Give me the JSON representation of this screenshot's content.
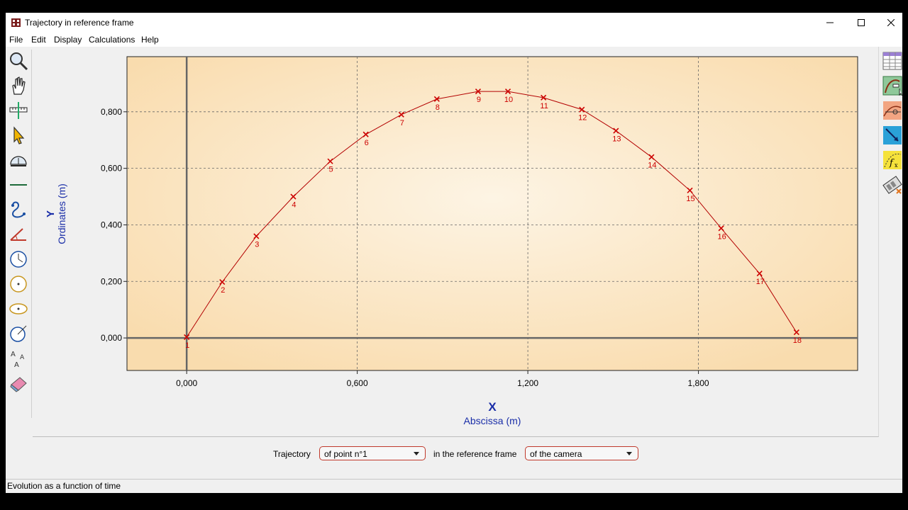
{
  "window": {
    "title": "Trajectory in reference frame"
  },
  "menu": {
    "items": [
      "File",
      "Edit",
      "Display",
      "Calculations",
      "Help"
    ]
  },
  "left_tools": [
    "magnifier-icon",
    "hand-icon",
    "axis-ruler-icon",
    "pointer-icon",
    "protractor-icon",
    "line-icon",
    "curve-icon",
    "angle-icon",
    "clock-circle-icon",
    "center-circle-icon",
    "ellipse-icon",
    "radius-circle-icon",
    "text-label-icon",
    "eraser-icon"
  ],
  "right_tools": [
    "table-icon",
    "trajectory-icon",
    "vector-icon",
    "arrow-icon",
    "function-icon",
    "film-icon"
  ],
  "chart_data": {
    "type": "scatter",
    "xlabel_symbol": "X",
    "xlabel": "Abscissa (m)",
    "ylabel_symbol": "Y",
    "ylabel": "Ordinates (m)",
    "xlim": [
      -0.21,
      2.36
    ],
    "ylim": [
      -0.115,
      0.995
    ],
    "x_ticks": [
      0,
      0.6,
      1.2,
      1.8
    ],
    "x_tick_labels": [
      "0,000",
      "0,600",
      "1,200",
      "1,800"
    ],
    "y_ticks": [
      0,
      0.2,
      0.4,
      0.6,
      0.8
    ],
    "y_tick_labels": [
      "0,000",
      "0,200",
      "0,400",
      "0,600",
      "0,800"
    ],
    "grid": true,
    "background": "#fbe7c6",
    "point_color": "#cc0000",
    "line_color": "#b30000",
    "series": [
      {
        "labels": [
          "1",
          "2",
          "3",
          "4",
          "5",
          "6",
          "7",
          "8",
          "9",
          "10",
          "11",
          "12",
          "13",
          "14",
          "15",
          "16",
          "17",
          "18"
        ],
        "x": [
          0.0,
          0.125,
          0.245,
          0.375,
          0.505,
          0.63,
          0.755,
          0.88,
          1.025,
          1.13,
          1.255,
          1.39,
          1.51,
          1.635,
          1.77,
          1.88,
          2.015,
          2.145
        ],
        "y": [
          0.003,
          0.198,
          0.36,
          0.5,
          0.625,
          0.72,
          0.79,
          0.845,
          0.872,
          0.872,
          0.85,
          0.808,
          0.733,
          0.64,
          0.522,
          0.388,
          0.228,
          0.02
        ]
      }
    ]
  },
  "bottom": {
    "trajectory_label": "Trajectory",
    "point_select": "of point n°1",
    "frame_label": "in the reference frame",
    "frame_select": "of the camera"
  },
  "status": {
    "text": "Evolution as a function of time"
  }
}
